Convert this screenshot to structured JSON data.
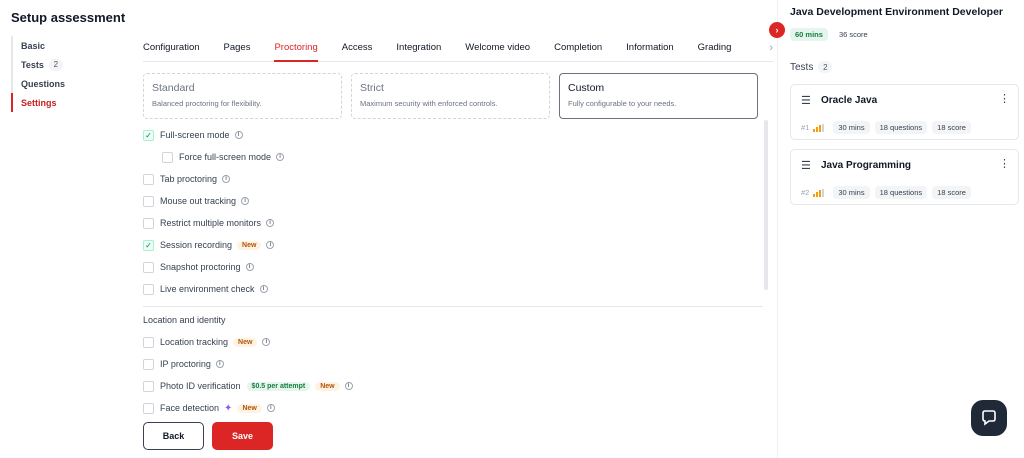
{
  "page": {
    "title": "Setup assessment"
  },
  "left_nav": [
    {
      "label": "Basic",
      "badge": ""
    },
    {
      "label": "Tests",
      "badge": "2"
    },
    {
      "label": "Questions",
      "badge": ""
    },
    {
      "label": "Settings",
      "badge": ""
    }
  ],
  "tabs": [
    "Configuration",
    "Pages",
    "Proctoring",
    "Access",
    "Integration",
    "Welcome video",
    "Completion",
    "Information",
    "Grading"
  ],
  "active_tab": "Proctoring",
  "modes": [
    {
      "title": "Standard",
      "desc": "Balanced proctoring for flexibility."
    },
    {
      "title": "Strict",
      "desc": "Maximum security with enforced controls."
    },
    {
      "title": "Custom",
      "desc": "Fully configurable to your needs."
    }
  ],
  "options": {
    "full_screen": "Full-screen mode",
    "force_full_screen": "Force full-screen mode",
    "tab": "Tab proctoring",
    "mouse_out": "Mouse out tracking",
    "monitors": "Restrict multiple monitors",
    "session": "Session recording",
    "snapshot": "Snapshot proctoring",
    "live_env": "Live environment check",
    "location": "Location tracking",
    "ip": "IP proctoring",
    "photo_id": "Photo ID verification",
    "face": "Face detection"
  },
  "section_location": "Location and identity",
  "badges": {
    "new": "New",
    "price": "$0.5 per attempt"
  },
  "buttons": {
    "back": "Back",
    "save": "Save"
  },
  "right": {
    "title": "Java Development Environment Developer",
    "duration": "60 mins",
    "score": "36 score",
    "tests_label": "Tests",
    "tests_count": "2",
    "tests": [
      {
        "name": "Oracle Java",
        "num": "#1",
        "duration": "30 mins",
        "questions": "18 questions",
        "score": "18 score"
      },
      {
        "name": "Java Programming",
        "num": "#2",
        "duration": "30 mins",
        "questions": "18 questions",
        "score": "18 score"
      }
    ]
  },
  "colors": {
    "accent": "#dc2626",
    "green_chip": "#e6f4ee",
    "new_badge": "#fef3e2"
  },
  "icons": {
    "info": "info-icon",
    "collapse": "chevron-right-icon",
    "test": "list-icon",
    "menu": "kebab-menu-icon",
    "help": "chat-bubble-icon",
    "sparkle": "sparkle-icon",
    "tabs_more": "chevron-right-icon"
  }
}
